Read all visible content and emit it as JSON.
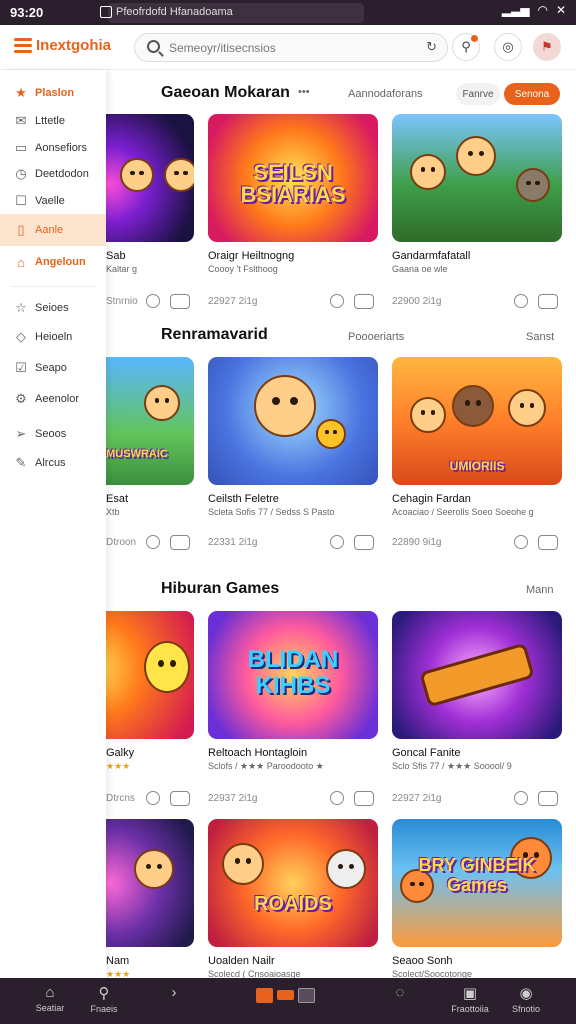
{
  "status": {
    "time": "93:20",
    "url": "Pfeofrdofd Hfanadoama"
  },
  "header": {
    "logo": "Inextgohia",
    "search_placeholder": "Semeoyr/itisecnsios"
  },
  "sidebar": {
    "items": [
      {
        "label": "Plaslon",
        "icon": "star-icon"
      },
      {
        "label": "Lttetle",
        "icon": "mail-icon"
      },
      {
        "label": "Aonsefiors",
        "icon": "folder-icon"
      },
      {
        "label": "Deetdodon",
        "icon": "clock-icon"
      },
      {
        "label": "Vaelle",
        "icon": "square-icon"
      },
      {
        "label": "Aanle",
        "icon": "file-icon"
      },
      {
        "label": "Angeloun",
        "icon": "home-icon"
      },
      {
        "label": "Seioes",
        "icon": "star-outline-icon"
      },
      {
        "label": "Heioeln",
        "icon": "tag-icon"
      },
      {
        "label": "Seapo",
        "icon": "check-icon"
      },
      {
        "label": "Aeenolor",
        "icon": "gear-icon"
      },
      {
        "label": "Seoos",
        "icon": "send-icon"
      },
      {
        "label": "Alrcus",
        "icon": "pen-icon"
      }
    ]
  },
  "sections": [
    {
      "title": "Gaeoan Mokaran",
      "more": "Aannodaforans",
      "filter_light": "Fanrve",
      "filter_orange": "Senona",
      "cards": [
        {
          "name": "Sab",
          "sub": "Kaltar g",
          "count": "Stnrnio",
          "thumb_text": ""
        },
        {
          "name": "Oraigr Heiltnogng",
          "sub": "Coooy 't Fslthoog",
          "count": "22927 2i1g",
          "thumb_text": "SEILSN BSIARIAS"
        },
        {
          "name": "Gandarmfafatall",
          "sub": "Gaana oe wle",
          "count": "22900 2i1g",
          "thumb_text": ""
        }
      ]
    },
    {
      "title": "Renramavarid",
      "more": "Poooeriarts",
      "right": "Sanst",
      "cards": [
        {
          "name": "Esat",
          "sub": "Xtb",
          "count": "Dtroon",
          "thumb_text": "MUSWRAIC"
        },
        {
          "name": "Ceilsth Feletre",
          "sub": "Scleta Sofis 77 / Sedss S Pasto",
          "count": "22331 2i1g",
          "thumb_text": ""
        },
        {
          "name": "Cehagin Fardan",
          "sub": "Acoaciao / Seerolls Soeo Soeohe g",
          "count": "22890 9i1g",
          "thumb_text": "UMIORIIS"
        }
      ]
    },
    {
      "title": "Hiburan Games",
      "right": "Mann",
      "cards": [
        {
          "name": "Galky",
          "sub": "★★★",
          "count": "Dtrcns",
          "thumb_text": ""
        },
        {
          "name": "Reltoach Hontagloin",
          "sub": "Sclofs / ★★★ Paroodooto ★",
          "count": "22937 2i1g",
          "thumb_text": "BLIDAN KIHBS"
        },
        {
          "name": "Goncal Fanite",
          "sub": "Sclo Sfis 77 / ★★★ Sooool/ 9",
          "count": "22927 2i1g",
          "thumb_text": ""
        }
      ]
    },
    {
      "cards": [
        {
          "name": "Nam",
          "sub": "★★★",
          "thumb_text": ""
        },
        {
          "name": "Uoalden Nailr",
          "sub": "Scolecd ( Cnsoaioasge",
          "thumb_text": "ROAIDS"
        },
        {
          "name": "Seaoo Sonh",
          "sub": "Scolect/Soocotonge",
          "thumb_text": "BRY GINBEIK Games"
        }
      ]
    }
  ],
  "bottom_nav": [
    {
      "label": "Seatiar",
      "icon": "home-icon"
    },
    {
      "label": "Fnaeis",
      "icon": "search-icon"
    },
    {
      "label": "",
      "icon": "chevron-right-icon"
    },
    {
      "label": "",
      "icon": "info-icon"
    },
    {
      "label": "Fraottoiia",
      "icon": "bag-icon"
    },
    {
      "label": "Sfnotio",
      "icon": "user-icon"
    }
  ]
}
